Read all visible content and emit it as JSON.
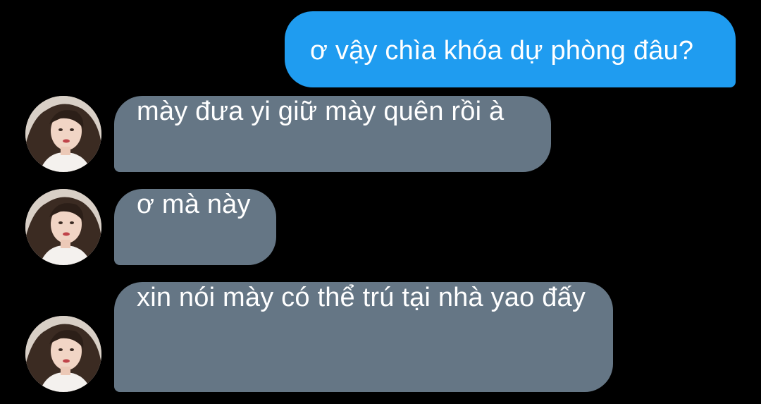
{
  "messages": [
    {
      "sender": "me",
      "text": "ơ vậy chìa khóa dự phòng đâu?"
    },
    {
      "sender": "contact",
      "text": "mày đưa yi giữ mày quên rồi à"
    },
    {
      "sender": "contact",
      "text": "ơ mà này"
    },
    {
      "sender": "contact",
      "text": "xin nói mày có thể trú tại nhà yao đấy"
    }
  ],
  "colors": {
    "background": "#000000",
    "outgoing_bubble": "#1f9cf0",
    "incoming_bubble": "#657685",
    "text": "#ffffff"
  },
  "icons": {
    "contact_avatar": "contact-avatar-photo"
  }
}
